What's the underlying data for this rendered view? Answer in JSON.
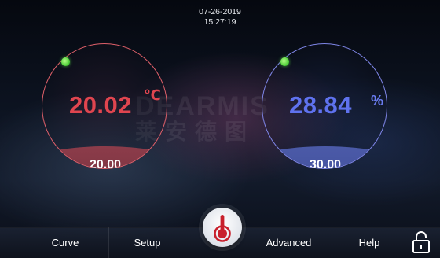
{
  "status": {
    "date": "07-26-2019",
    "time": "15:27:19"
  },
  "watermark": {
    "line1": "DEARMIS",
    "line2": "莱安德图"
  },
  "temperature": {
    "process_value": "20.02",
    "unit": "℃",
    "set_value": "20.00",
    "indicator": "green-status-dot",
    "color": "#e0454f"
  },
  "humidity": {
    "process_value": "28.84",
    "unit": "%",
    "set_value": "30.00",
    "indicator": "green-status-dot",
    "color": "#5f72ee"
  },
  "nav": {
    "curve": "Curve",
    "setup": "Setup",
    "advanced": "Advanced",
    "help": "Help"
  },
  "icons": {
    "center_button": "thermometer-icon",
    "right_button": "lock-icon"
  }
}
